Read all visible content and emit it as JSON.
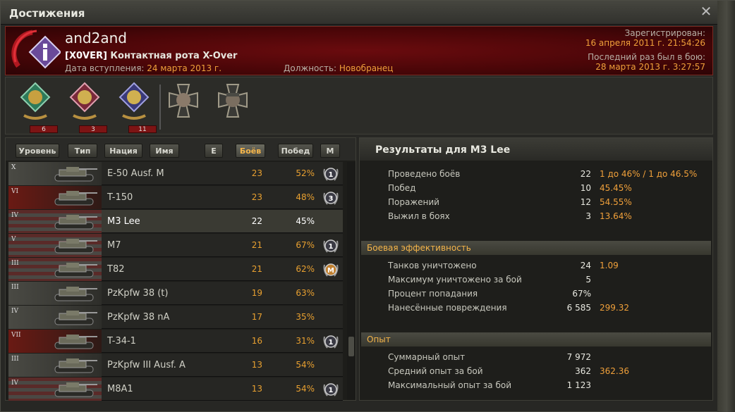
{
  "window": {
    "title": "Достижения",
    "close_label": "✕"
  },
  "player": {
    "name": "and2and",
    "clan_tag": "[X0VER]",
    "clan_name": " Контактная рота X-Over",
    "join_label": "Дата вступления: ",
    "join_date": "24 марта 2013 г.",
    "role_label": "Должность: ",
    "role": "Новобранец",
    "registered_label": "Зарегистрирован:",
    "registered": "16 апреля 2011 г. 21:54:26",
    "last_battle_label": "Последний раз был в бою:",
    "last_battle": "28 марта 2013 г. 3:27:57"
  },
  "medals": [
    {
      "icon": "medal-green-icon",
      "count": "6"
    },
    {
      "icon": "medal-red-icon",
      "count": "3"
    },
    {
      "icon": "medal-blue-icon",
      "count": "11"
    },
    {
      "icon": "iron-cross-portrait-icon"
    },
    {
      "icon": "iron-cross-portrait-cap-icon"
    }
  ],
  "sort_buttons": [
    {
      "label": "Уровень",
      "active": false
    },
    {
      "label": "Тип",
      "active": false
    },
    {
      "label": "Нация",
      "active": false
    },
    {
      "label": "Имя",
      "active": false
    },
    {
      "label": "E",
      "active": false
    },
    {
      "label": "Боёв",
      "active": true
    },
    {
      "label": "Побед",
      "active": false
    },
    {
      "label": "М",
      "active": false
    }
  ],
  "vehicles": [
    {
      "tier": "X",
      "nation": "germany",
      "name": "E-50 Ausf. M",
      "battles": "23",
      "wins": "52%",
      "mastery": "1"
    },
    {
      "tier": "VI",
      "nation": "ussr",
      "name": "T-150",
      "battles": "23",
      "wins": "48%",
      "mastery": "3"
    },
    {
      "tier": "IV",
      "nation": "usa",
      "name": "M3 Lee",
      "battles": "22",
      "wins": "45%",
      "mastery": "",
      "selected": true
    },
    {
      "tier": "V",
      "nation": "usa",
      "name": "M7",
      "battles": "21",
      "wins": "67%",
      "mastery": "1"
    },
    {
      "tier": "III",
      "nation": "usa",
      "name": "T82",
      "battles": "21",
      "wins": "62%",
      "mastery": "M"
    },
    {
      "tier": "III",
      "nation": "germany",
      "name": "PzKpfw 38 (t)",
      "battles": "19",
      "wins": "63%",
      "mastery": ""
    },
    {
      "tier": "IV",
      "nation": "germany",
      "name": "PzKpfw 38 nA",
      "battles": "17",
      "wins": "35%",
      "mastery": ""
    },
    {
      "tier": "VII",
      "nation": "ussr",
      "name": "T-34-1",
      "battles": "16",
      "wins": "31%",
      "mastery": "1"
    },
    {
      "tier": "III",
      "nation": "germany",
      "name": "PzKpfw III Ausf. A",
      "battles": "13",
      "wins": "54%",
      "mastery": ""
    },
    {
      "tier": "IV",
      "nation": "usa",
      "name": "M8A1",
      "battles": "13",
      "wins": "54%",
      "mastery": "1"
    }
  ],
  "results": {
    "title": "Результаты для M3 Lee",
    "general": [
      {
        "label": "Проведено боёв",
        "value": "22",
        "extra": "1 до 46% / 1 до 46.5%"
      },
      {
        "label": "Побед",
        "value": "10",
        "extra": "45.45%"
      },
      {
        "label": "Поражений",
        "value": "12",
        "extra": "54.55%"
      },
      {
        "label": "Выжил в боях",
        "value": "3",
        "extra": "13.64%"
      }
    ],
    "efficiency_title": "Боевая эффективность",
    "efficiency": [
      {
        "label": "Танков уничтожено",
        "value": "24",
        "extra": "1.09"
      },
      {
        "label": "Максимум уничтожено за бой",
        "value": "5",
        "extra": ""
      },
      {
        "label": "Процент попадания",
        "value": "67%",
        "extra": ""
      },
      {
        "label": "Нанесённые повреждения",
        "value": "6 585",
        "extra": "299.32"
      }
    ],
    "xp_title": "Опыт",
    "xp": [
      {
        "label": "Суммарный опыт",
        "value": "7 972",
        "extra": ""
      },
      {
        "label": "Средний опыт за бой",
        "value": "362",
        "extra": "362.36"
      },
      {
        "label": "Максимальный опыт за бой",
        "value": "1 123",
        "extra": ""
      }
    ]
  },
  "colors": {
    "accent": "#f0a03a",
    "header_red": "#5a0709",
    "active_sort": "#f5b54a"
  }
}
